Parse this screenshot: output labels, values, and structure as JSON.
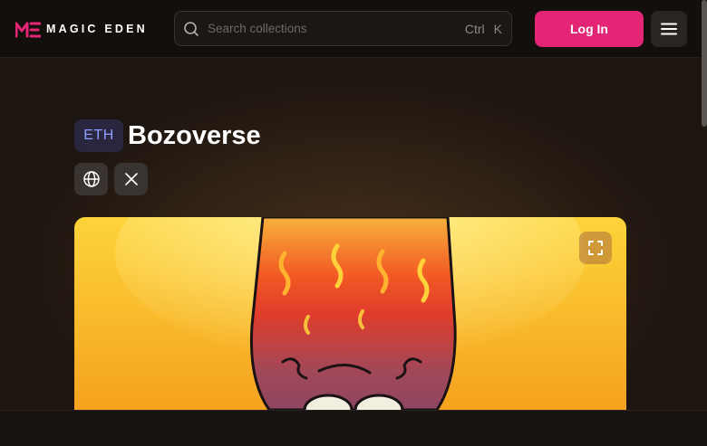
{
  "header": {
    "logo": {
      "text": "MAGIC EDEN",
      "icon": "magic-eden-logo-icon"
    },
    "search": {
      "placeholder": "Search collections",
      "shortcut_ctrl": "Ctrl",
      "shortcut_key": "K",
      "icon": "search-icon"
    },
    "login_label": "Log In",
    "menu_icon": "hamburger-menu-icon"
  },
  "collection": {
    "chain": "ETH",
    "name": "Bozoverse",
    "social": [
      {
        "icon": "globe-icon"
      },
      {
        "icon": "x-twitter-icon"
      }
    ],
    "banner": {
      "expand_icon": "expand-icon"
    }
  },
  "colors": {
    "accent": "#e42575",
    "chain_text": "#8ea0ff",
    "background": "#120f0c"
  }
}
